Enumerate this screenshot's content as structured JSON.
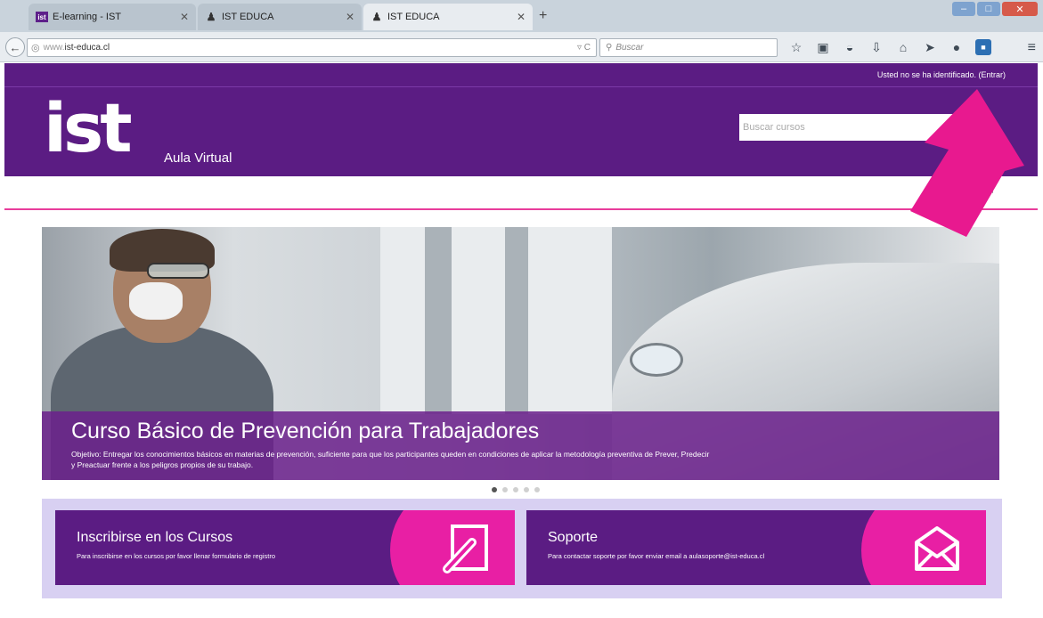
{
  "browser": {
    "tabs": [
      {
        "label": "E-learning - IST",
        "favicon": "ist",
        "active": false
      },
      {
        "label": "IST EDUCA",
        "favicon": "user-icon",
        "active": false
      },
      {
        "label": "IST EDUCA",
        "favicon": "user-icon",
        "active": true
      }
    ],
    "url": "www.ist-educa.cl",
    "url_prefix": "www.",
    "url_domain": "ist-educa.cl",
    "search_placeholder": "Buscar",
    "toolbar_icons": [
      "star-icon",
      "clipboard-icon",
      "pocket-icon",
      "download-icon",
      "home-icon",
      "send-icon",
      "chat-icon",
      "notification-icon"
    ]
  },
  "site": {
    "login_info": "Usted no se ha identificado. (Entrar)",
    "logo_text": "ist",
    "subtitle": "Aula Virtual",
    "search_placeholder": "Buscar cursos"
  },
  "hero": {
    "title": "Curso Básico de Prevención para Trabajadores",
    "description": "Objetivo: Entregar los conocimientos básicos en materias de prevención, suficiente para que los participantes queden en condiciones de aplicar la metodología preventiva de Prever, Predecir y Preactuar frente a los peligros propios de su trabajo.",
    "slides": 5,
    "active_slide": 0
  },
  "cards": [
    {
      "title": "Inscribirse en los Cursos",
      "description": "Para inscribirse en los cursos por favor llenar formulario de registro",
      "icon": "edit-document-icon"
    },
    {
      "title": "Soporte",
      "description": "Para contactar soporte por favor enviar email a aulasoporte@ist-educa.cl",
      "icon": "envelope-icon"
    }
  ],
  "colors": {
    "brand_purple": "#5b1c83",
    "accent_pink": "#e81fa4",
    "card_bg": "#d8d0f2"
  }
}
